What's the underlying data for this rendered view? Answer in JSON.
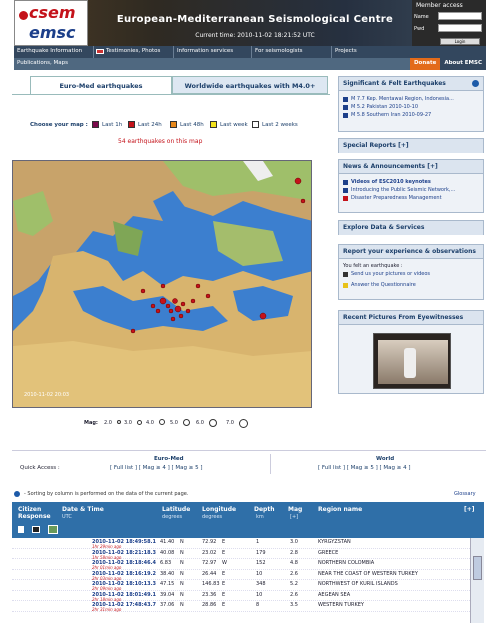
{
  "header": {
    "logo_top": "csem",
    "logo_bottom": "emsc",
    "title": "European-Mediterranean Seismological Centre",
    "current_time": "Current time: 2010-11-02 18:21:52 UTC"
  },
  "member": {
    "title": "Member access",
    "name_label": "Name",
    "pwd_label": "Pwd",
    "login_label": "Login"
  },
  "nav": {
    "items": [
      "Earthquake Information",
      "Testimonies, Photos",
      "Information services",
      "For seismologists",
      "Projects"
    ],
    "row2": [
      "Publications, Maps"
    ],
    "donate": "Donate",
    "about": "About EMSC"
  },
  "tabs": {
    "active": "Euro-Med earthquakes",
    "other": "Worldwide earthquakes with M4.0+"
  },
  "choose": {
    "label": "Choose your map :",
    "options": [
      {
        "label": "Last 1h",
        "color": "#7a0a4a"
      },
      {
        "label": "Last 24h",
        "color": "#c4121a"
      },
      {
        "label": "Last 48h",
        "color": "#e8881a"
      },
      {
        "label": "Last week",
        "color": "#f3e21a"
      },
      {
        "label": "Last 2 weeks",
        "color": "#ffffff"
      }
    ]
  },
  "eq_count": "54 earthquakes on this map",
  "map": {
    "timestamp": "2010-11-02 20:03"
  },
  "magnitude": {
    "label": "Mag:",
    "values": [
      "2.0",
      "3.0",
      "4.0",
      "5.0",
      "6.0",
      "7.0"
    ]
  },
  "panels": {
    "significant": {
      "title": "Significant & Felt Earthquakes",
      "items": [
        "M 7.7 Kep. Mentawai Region, Indonesia...",
        "M 5.2 Pakistan 2010-10-10",
        "M 5.8 Southern Iran 2010-09-27"
      ]
    },
    "special": {
      "title": "Special Reports [+]"
    },
    "news": {
      "title": "News & Announcements [+]",
      "items": [
        "Videos of ESC2010 keynotes",
        "Introducing the Public Seismic Network,...",
        "Disaster Preparedness Management"
      ]
    },
    "explore": {
      "title": "Explore Data & Services"
    },
    "report": {
      "title": "Report your experience & observations",
      "intro": "You felt an earthquake :",
      "items": [
        "Send us your pictures or videos",
        "Answer the Questionnaire"
      ]
    },
    "pictures": {
      "title": "Recent Pictures From Eyewitnesses"
    }
  },
  "quick_access": {
    "label": "Quick Access :",
    "euromed": {
      "title": "Euro-Med",
      "links": "[ Full list ] [ Mag ≥ 4 ] [ Mag ≥ 5 ]"
    },
    "world": {
      "title": "World",
      "links": "[ Full list ] [ Mag ≥ 5 ] [ Mag ≥ 4 ]"
    }
  },
  "info": "- Sorting by column is performed on the data of the current page.",
  "glossary": "Glossary",
  "table": {
    "headers": {
      "citizen": "Citizen",
      "response": "Response",
      "date": "Date & Time",
      "date_unit": "UTC",
      "lat": "Latitude",
      "lat_unit": "degrees",
      "lon": "Longitude",
      "lon_unit": "degrees",
      "depth": "Depth",
      "depth_unit": "km",
      "mag": "Mag",
      "mag_unit": "[+]",
      "region": "Region name",
      "expand": "[+]"
    },
    "rows": [
      {
        "dt": "2010-11-02 18:49:58.1",
        "ago": "1hr 29min ago",
        "lat": "41.40",
        "ns": "N",
        "lon": "72.92",
        "ew": "E",
        "depth": "1",
        "mag": "3.0",
        "region": "KYRGYZSTAN"
      },
      {
        "dt": "2010-11-02 18:21:18.3",
        "ago": "1hr 58min ago",
        "lat": "40.08",
        "ns": "N",
        "lon": "23.02",
        "ew": "E",
        "depth": "179",
        "mag": "2.8",
        "region": "GREECE"
      },
      {
        "dt": "2010-11-02 18:18:46.4",
        "ago": "2hr 01min ago",
        "lat": "6.83",
        "ns": "N",
        "lon": "72.97",
        "ew": "W",
        "depth": "152",
        "mag": "4.8",
        "region": "NORTHERN COLOMBIA"
      },
      {
        "dt": "2010-11-02 18:16:19.2",
        "ago": "2hr 03min ago",
        "lat": "38.40",
        "ns": "N",
        "lon": "26.44",
        "ew": "E",
        "depth": "10",
        "mag": "2.6",
        "region": "NEAR THE COAST OF WESTERN TURKEY"
      },
      {
        "dt": "2010-11-02 18:10:13.3",
        "ago": "2hr 09min ago",
        "lat": "47.15",
        "ns": "N",
        "lon": "146.83",
        "ew": "E",
        "depth": "348",
        "mag": "5.2",
        "region": "NORTHWEST OF KURIL ISLANDS"
      },
      {
        "dt": "2010-11-02 18:01:49.1",
        "ago": "2hr 18min ago",
        "lat": "39.04",
        "ns": "N",
        "lon": "23.36",
        "ew": "E",
        "depth": "10",
        "mag": "2.6",
        "region": "AEGEAN SEA"
      },
      {
        "dt": "2010-11-02 17:48:43.7",
        "ago": "2hr 31min ago",
        "lat": "37.06",
        "ns": "N",
        "lon": "28.86",
        "ew": "E",
        "depth": "8",
        "mag": "3.5",
        "region": "WESTERN TURKEY"
      }
    ]
  }
}
